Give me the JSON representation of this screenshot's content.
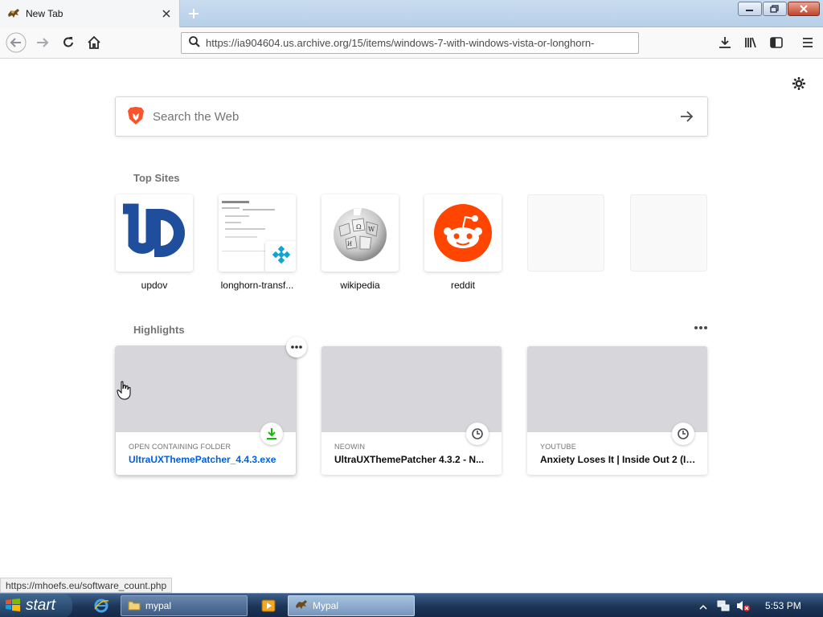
{
  "browser": {
    "tab_title": "New Tab",
    "url": "https://ia904604.us.archive.org/15/items/windows-7-with-windows-vista-or-longhorn-"
  },
  "search": {
    "placeholder": "Search the Web"
  },
  "top_sites": {
    "title": "Top Sites",
    "items": [
      {
        "label": "updov"
      },
      {
        "label": "longhorn-transf..."
      },
      {
        "label": "wikipedia"
      },
      {
        "label": "reddit"
      },
      {
        "label": ""
      },
      {
        "label": ""
      }
    ]
  },
  "highlights": {
    "title": "Highlights",
    "cards": [
      {
        "source": "OPEN CONTAINING FOLDER",
        "title": "UltraUXThemePatcher_4.4.3.exe",
        "icon": "download-icon"
      },
      {
        "source": "NEOWIN",
        "title": "UltraUXThemePatcher 4.3.2 - N...",
        "icon": "clock-icon"
      },
      {
        "source": "YOUTUBE",
        "title": "Anxiety Loses It | Inside Out 2 (In...",
        "icon": "clock-icon"
      }
    ]
  },
  "status_url": "https://mhoefs.eu/software_count.php",
  "taskbar": {
    "start_label": "start",
    "items": [
      {
        "label": "mypal"
      },
      {
        "label": "Mypal"
      }
    ],
    "clock": "5:53 PM"
  },
  "colors": {
    "accent": "#0060df",
    "reddit": "#ff4500",
    "updov": "#1f4f9c",
    "download_green": "#12bc00"
  }
}
